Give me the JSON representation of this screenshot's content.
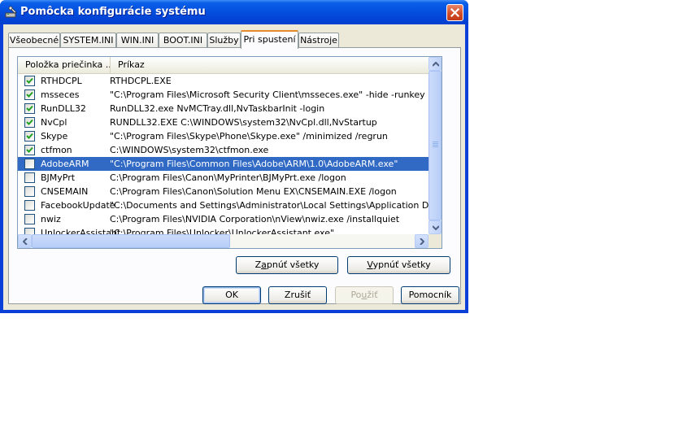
{
  "window": {
    "title": "Pomôcka konfigurácie systému"
  },
  "tabs": [
    {
      "label": "Všeobecné"
    },
    {
      "label": "SYSTEM.INI"
    },
    {
      "label": "WIN.INI"
    },
    {
      "label": "BOOT.INI"
    },
    {
      "label": "Služby"
    },
    {
      "label": "Pri spustení",
      "active": true
    },
    {
      "label": "Nástroje"
    }
  ],
  "list": {
    "columns": [
      "Položka priečinka ...",
      "Príkaz"
    ],
    "rows": [
      {
        "name": "RTHDCPL",
        "command": "RTHDCPL.EXE",
        "checked": true
      },
      {
        "name": "msseces",
        "command": "\"C:\\Program Files\\Microsoft Security Client\\msseces.exe\" -hide -runkey",
        "checked": true
      },
      {
        "name": "RunDLL32",
        "command": "RunDLL32.exe NvMCTray.dll,NvTaskbarInit -login",
        "checked": true
      },
      {
        "name": "NvCpl",
        "command": "RUNDLL32.EXE C:\\WINDOWS\\system32\\NvCpl.dll,NvStartup",
        "checked": true
      },
      {
        "name": "Skype",
        "command": "\"C:\\Program Files\\Skype\\Phone\\Skype.exe\" /minimized /regrun",
        "checked": true
      },
      {
        "name": "ctfmon",
        "command": "C:\\WINDOWS\\system32\\ctfmon.exe",
        "checked": true
      },
      {
        "name": "AdobeARM",
        "command": "\"C:\\Program Files\\Common Files\\Adobe\\ARM\\1.0\\AdobeARM.exe\"",
        "checked": false,
        "selected": true
      },
      {
        "name": "BJMyPrt",
        "command": "C:\\Program Files\\Canon\\MyPrinter\\BJMyPrt.exe /logon",
        "checked": false
      },
      {
        "name": "CNSEMAIN",
        "command": "C:\\Program Files\\Canon\\Solution Menu EX\\CNSEMAIN.EXE /logon",
        "checked": false
      },
      {
        "name": "FacebookUpdate",
        "command": "\"C:\\Documents and Settings\\Administrator\\Local Settings\\Application Data\\Facebo",
        "checked": false
      },
      {
        "name": "nwiz",
        "command": "C:\\Program Files\\NVIDIA Corporation\\nView\\nwiz.exe /installquiet",
        "checked": false
      },
      {
        "name": "UnlockerAssistant",
        "command": "\"C:\\Program Files\\Unlocker\\UnlockerAssistant.exe\"",
        "checked": false
      }
    ]
  },
  "panel_buttons": {
    "enable_all": {
      "pre": "Z",
      "mn": "a",
      "post": "pnúť všetky"
    },
    "disable_all": {
      "pre": "",
      "mn": "V",
      "post": "ypnúť všetky"
    }
  },
  "dialog_buttons": {
    "ok": "OK",
    "cancel": "Zrušiť",
    "apply": {
      "pre": "Po",
      "mn": "u",
      "post": "žiť"
    },
    "help": "Pomocník"
  },
  "colors": {
    "titlebar": "#0450df",
    "selection": "#316ac5",
    "active_tab_accent": "#e68b2c",
    "check": "#21a121"
  }
}
